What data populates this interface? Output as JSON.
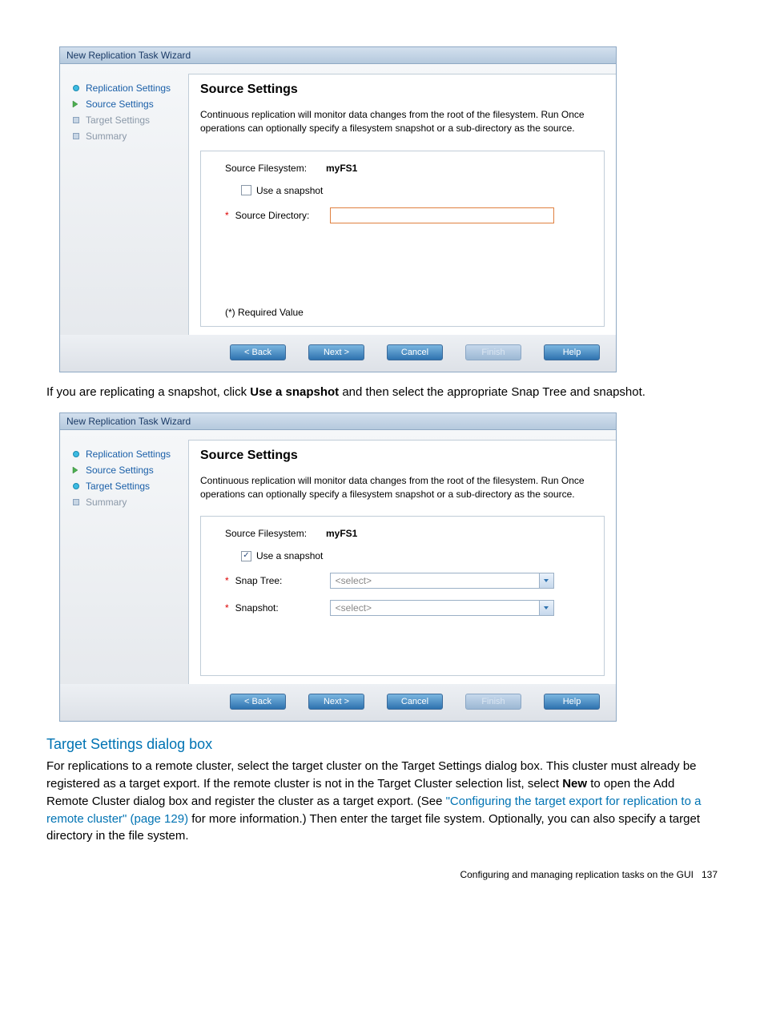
{
  "wizard": {
    "title": "New Replication Task Wizard",
    "sidebar": {
      "items": [
        {
          "label": "Replication Settings",
          "state": "done"
        },
        {
          "label": "Source Settings",
          "state": "current"
        },
        {
          "label": "Target Settings",
          "state": "pending"
        },
        {
          "label": "Summary",
          "state": "pending"
        }
      ]
    },
    "content": {
      "heading": "Source Settings",
      "description": "Continuous replication will monitor data changes from the root of the filesystem. Run Once operations can optionally specify a filesystem snapshot or a sub-directory as the source.",
      "labels": {
        "sourceFilesystem": "Source Filesystem:",
        "useSnapshot": "Use a snapshot",
        "sourceDirectory": "Source Directory:",
        "snapTree": "Snap Tree:",
        "snapshot": "Snapshot:",
        "requiredNote": "(*) Required Value"
      },
      "values": {
        "sourceFilesystem": "myFS1",
        "selectPlaceholder": "<select>"
      }
    },
    "buttons": {
      "back": "< Back",
      "next": "Next >",
      "cancel": "Cancel",
      "finish": "Finish",
      "help": "Help"
    }
  },
  "wizard2_sidebar_target_state": "done",
  "doc": {
    "para1_pre": "If you are replicating a snapshot, click ",
    "para1_bold": "Use a snapshot",
    "para1_post": " and then select the appropriate Snap Tree and snapshot.",
    "section_heading": "Target Settings dialog box",
    "para2_a": "For replications to a remote cluster, select the target cluster on the Target Settings dialog box. This cluster must already be registered as a target export. If the remote cluster is not in the Target Cluster selection list, select ",
    "para2_bold": "New",
    "para2_b": " to open the Add Remote Cluster dialog box and register the cluster as a target export. (See ",
    "para2_link": "\"Configuring the target export for replication to a remote cluster\" (page 129)",
    "para2_c": " for more information.) Then enter the target file system. Optionally, you can also specify a target directory in the file system.",
    "footer_text": "Configuring and managing replication tasks on the GUI",
    "footer_page": "137"
  }
}
